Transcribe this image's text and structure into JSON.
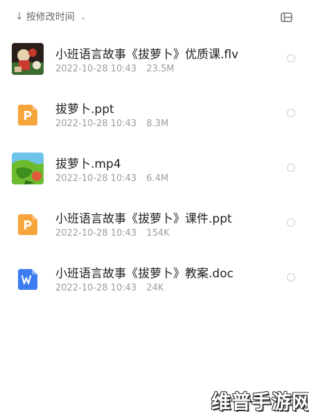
{
  "toolbar": {
    "sort_icon": "arrow-down-icon",
    "sort_label": "按修改时间",
    "dropdown_icon": "chevron-down-icon",
    "view_toggle_icon": "list-view-icon"
  },
  "files": [
    {
      "name": "小班语言故事《拔萝卜》优质课.flv",
      "date": "2022-10-28 10:43",
      "size": "23.5M",
      "type": "video-thumbnail"
    },
    {
      "name": "拔萝卜.ppt",
      "date": "2022-10-28 10:43",
      "size": "8.3M",
      "type": "ppt-icon"
    },
    {
      "name": "拔萝卜.mp4",
      "date": "2022-10-28 10:43",
      "size": "6.4M",
      "type": "video-thumbnail"
    },
    {
      "name": "小班语言故事《拔萝卜》课件.ppt",
      "date": "2022-10-28 10:43",
      "size": "154K",
      "type": "ppt-icon"
    },
    {
      "name": "小班语言故事《拔萝卜》教案.doc",
      "date": "2022-10-28 10:43",
      "size": "24K",
      "type": "doc-icon"
    }
  ],
  "watermark": "维普手游网",
  "colors": {
    "ppt": "#f6a43c",
    "doc": "#3c7cf0",
    "title_text": "#1f1f1f",
    "meta_text": "#9d9d9d"
  }
}
